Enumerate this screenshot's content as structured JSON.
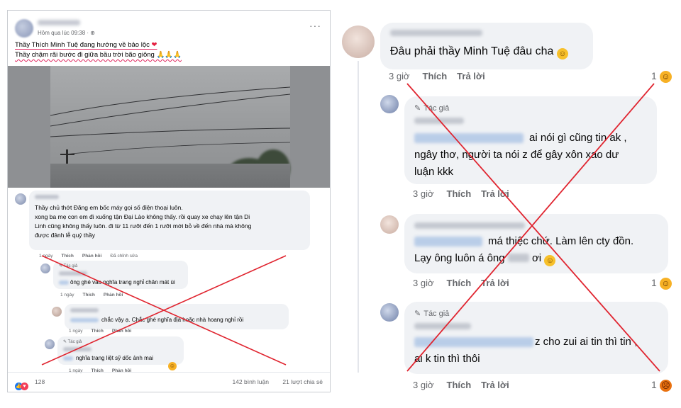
{
  "left_post": {
    "time": "Hôm qua lúc 09:38 · ",
    "more": "···",
    "line1": "Thầy Thích Minh Tuệ đang hướng về bảo lộc ",
    "line1_emoji": "❤",
    "line2": "Thầy chậm rãi bước đi giữa bầu trời bão giông 🙏🙏🙏",
    "first_comment_lines": [
      "Thầy chủ thớt Đăng em bốc máy gọi số điện thoại luôn.",
      "xong ba mẹ con em đi xuống tận Đại Lào không thấy. rồi quay xe chạy lên tận Di",
      "Linh cũng không thấy luôn. đi từ 11 rưỡi đến 1 rưỡi mới bỏ về đến nhà mà không",
      "được đảnh lễ quý thầy"
    ],
    "first_meta": {
      "time": "1 ngày",
      "like": "Thích",
      "reply": "Phản hồi",
      "edited": "Đã chỉnh sửa"
    },
    "replies": [
      {
        "author": "Tác giả",
        "text": "ông ghé vào nghĩa trang nghỉ chân mát ùi",
        "time": "1 ngày",
        "like": "Thích",
        "reply": "Phản hồi"
      },
      {
        "author": "",
        "text": "chắc vậy ạ. Chắc ghé nghĩa địa hoặc nhà hoang nghỉ rồi",
        "time": "1 ngày",
        "like": "Thích",
        "reply": "Phản hồi"
      },
      {
        "author": "Tác giả",
        "text": "nghĩa trang liệt sỹ dốc ảnh mai",
        "time": "1 ngày",
        "like": "Thích",
        "reply": "Phản hồi"
      }
    ],
    "reactions": "128",
    "comments_count": "142 bình luận",
    "shares_count": "21 lượt chia sẻ"
  },
  "right_thread": {
    "top_comment": {
      "text": "Đâu phải thầy Minh Tuệ đâu cha",
      "time": "3 giờ",
      "like": "Thích",
      "reply": "Trả lời",
      "react_count": "1"
    },
    "replies": [
      {
        "author_tag": "Tác giả",
        "lines": [
          "ai nói gì cũng tin ak ,",
          "ngây thơ, người ta nói z để gây xôn xao dư",
          "luận kkk"
        ],
        "time": "3 giờ",
        "like": "Thích",
        "reply": "Trả lời",
        "react_count": ""
      },
      {
        "author_tag": "",
        "lines": [
          "má thiệc chứ. Làm lên cty đồn.",
          "Lạy ông luôn á ông",
          "ơi"
        ],
        "time": "3 giờ",
        "like": "Thích",
        "reply": "Trả lời",
        "react_count": "1"
      },
      {
        "author_tag": "Tác giả",
        "lines": [
          "z cho zui ai tin thì tin ,",
          "ai k tin thì thôi"
        ],
        "time": "3 giờ",
        "like": "Thích",
        "reply": "Trả lời",
        "react_count": "1"
      }
    ]
  },
  "colors": {
    "cross": "#e0242f",
    "bubble": "#f0f2f5",
    "meta": "#65676b"
  }
}
